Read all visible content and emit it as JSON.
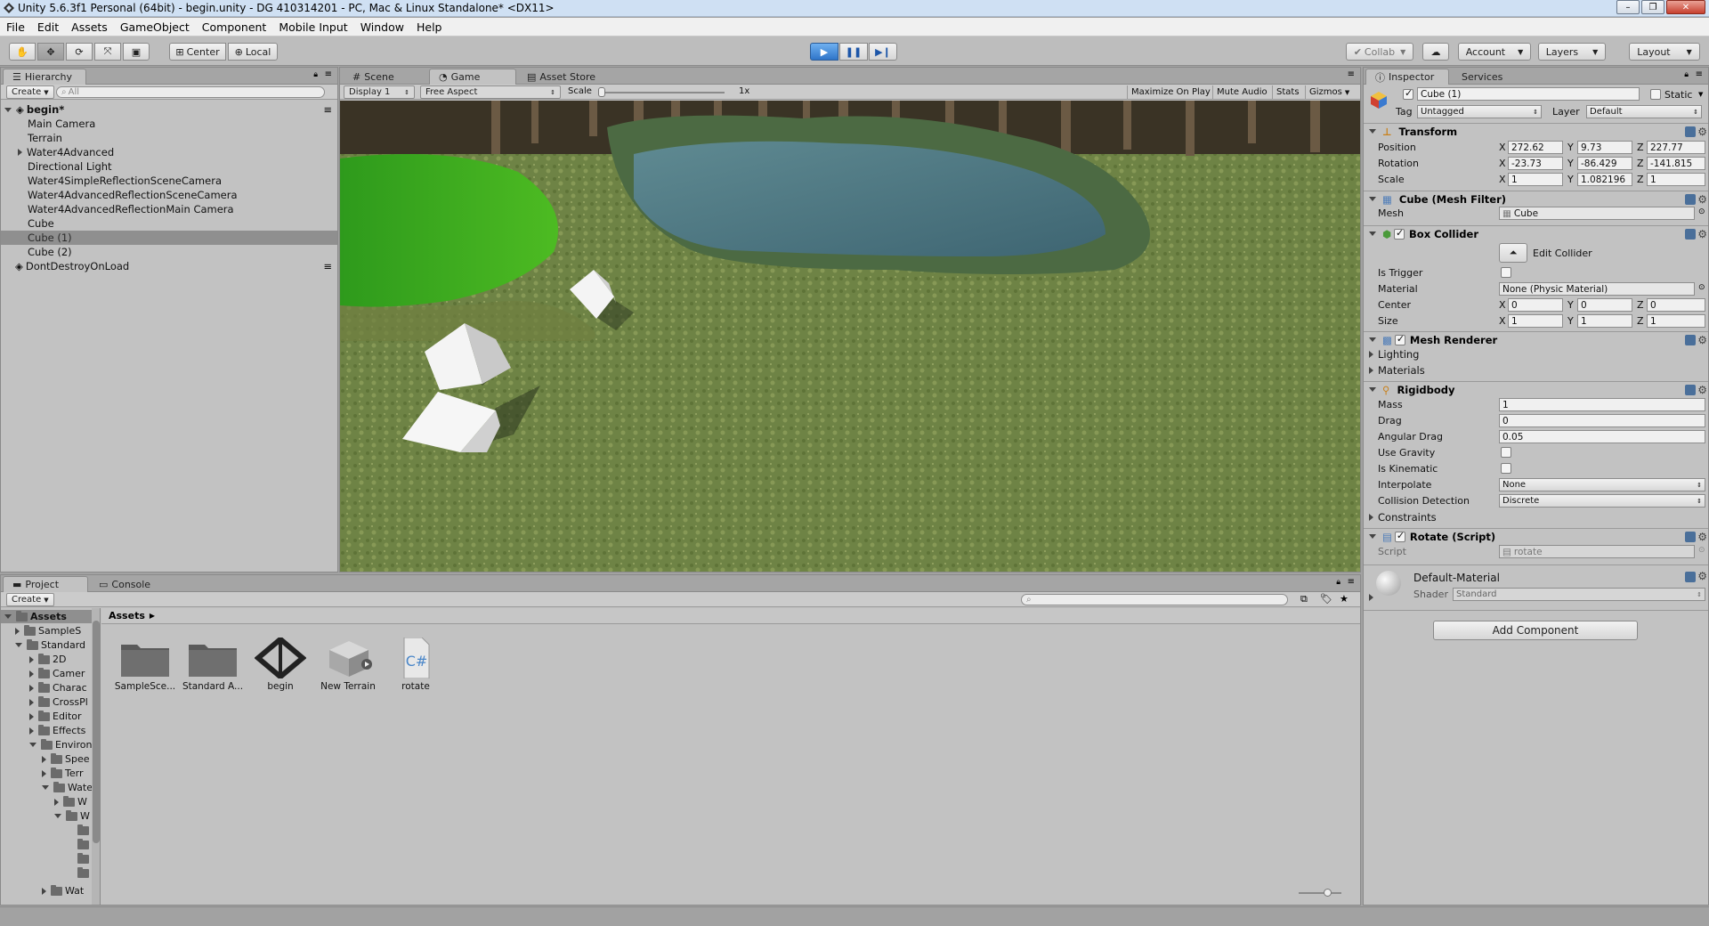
{
  "window": {
    "title": "Unity 5.6.3f1 Personal (64bit) - begin.unity - DG  410314201 - PC, Mac & Linux Standalone* <DX11>"
  },
  "menu": [
    "File",
    "Edit",
    "Assets",
    "GameObject",
    "Component",
    "Mobile Input",
    "Window",
    "Help"
  ],
  "toolbar": {
    "center": "Center",
    "local": "Local",
    "collab": "Collab",
    "account": "Account",
    "layers": "Layers",
    "layout": "Layout"
  },
  "hierarchy": {
    "tab": "Hierarchy",
    "create": "Create",
    "search_placeholder": "All",
    "scene": "begin*",
    "items": [
      "Main Camera",
      "Terrain",
      "Water4Advanced",
      "Directional Light",
      "Water4SimpleReflectionSceneCamera",
      "Water4AdvancedReflectionSceneCamera",
      "Water4AdvancedReflectionMain Camera",
      "Cube",
      "Cube (1)",
      "Cube (2)"
    ],
    "dont_destroy": "DontDestroyOnLoad"
  },
  "game": {
    "tabs": [
      "Scene",
      "Game",
      "Asset Store"
    ],
    "display": "Display 1",
    "aspect": "Free Aspect",
    "scale_label": "Scale",
    "scale_value": "1x",
    "toggles": [
      "Maximize On Play",
      "Mute Audio",
      "Stats",
      "Gizmos"
    ]
  },
  "inspector": {
    "tabs": [
      "Inspector",
      "Services"
    ],
    "object_name": "Cube (1)",
    "static": "Static",
    "tag_label": "Tag",
    "tag": "Untagged",
    "layer_label": "Layer",
    "layer": "Default",
    "transform": {
      "title": "Transform",
      "position_label": "Position",
      "rotation_label": "Rotation",
      "scale_label": "Scale",
      "position": [
        "272.62",
        "9.73",
        "227.77"
      ],
      "rotation": [
        "-23.73",
        "-86.429",
        "-141.815"
      ],
      "scale": [
        "1",
        "1.082196",
        "1"
      ]
    },
    "axes": [
      "X",
      "Y",
      "Z"
    ],
    "mesh_filter": {
      "title": "Cube (Mesh Filter)",
      "mesh_label": "Mesh",
      "mesh": "Cube"
    },
    "box_collider": {
      "title": "Box Collider",
      "edit": "Edit Collider",
      "is_trigger": "Is Trigger",
      "material_label": "Material",
      "material": "None (Physic Material)",
      "center_label": "Center",
      "center": [
        "0",
        "0",
        "0"
      ],
      "size_label": "Size",
      "size": [
        "1",
        "1",
        "1"
      ]
    },
    "mesh_renderer": {
      "title": "Mesh Renderer",
      "lighting": "Lighting",
      "materials": "Materials"
    },
    "rigidbody": {
      "title": "Rigidbody",
      "mass_label": "Mass",
      "mass": "1",
      "drag_label": "Drag",
      "drag": "0",
      "angular_label": "Angular Drag",
      "angular": "0.05",
      "gravity": "Use Gravity",
      "kinematic": "Is Kinematic",
      "interpolate_label": "Interpolate",
      "interpolate": "None",
      "collision_label": "Collision Detection",
      "collision": "Discrete",
      "constraints": "Constraints"
    },
    "rotate": {
      "title": "Rotate (Script)",
      "script_label": "Script",
      "script": "rotate"
    },
    "material": {
      "name": "Default-Material",
      "shader_label": "Shader",
      "shader": "Standard"
    },
    "add_component": "Add Component"
  },
  "project": {
    "tabs": [
      "Project",
      "Console"
    ],
    "create": "Create",
    "breadcrumb": "Assets",
    "tree": [
      {
        "name": "Assets",
        "indent": 0,
        "open": true
      },
      {
        "name": "SampleS",
        "indent": 1,
        "open": false
      },
      {
        "name": "Standard",
        "indent": 1,
        "open": true
      },
      {
        "name": "2D",
        "indent": 2,
        "open": false
      },
      {
        "name": "Camer",
        "indent": 2,
        "open": false
      },
      {
        "name": "Charac",
        "indent": 2,
        "open": false
      },
      {
        "name": "CrossPl",
        "indent": 2,
        "open": false
      },
      {
        "name": "Editor",
        "indent": 2,
        "open": false
      },
      {
        "name": "Effects",
        "indent": 2,
        "open": false
      },
      {
        "name": "Environ",
        "indent": 2,
        "open": true
      },
      {
        "name": "Spee",
        "indent": 3,
        "open": false
      },
      {
        "name": "Terr",
        "indent": 3,
        "open": false
      },
      {
        "name": "Wate",
        "indent": 3,
        "open": true
      },
      {
        "name": "W",
        "indent": 4,
        "open": false
      },
      {
        "name": "W",
        "indent": 4,
        "open": true
      }
    ],
    "tree_last": "Wat",
    "assets": [
      {
        "name": "SampleSce...",
        "kind": "folder"
      },
      {
        "name": "Standard A...",
        "kind": "folder"
      },
      {
        "name": "begin",
        "kind": "unity"
      },
      {
        "name": "New Terrain",
        "kind": "terrain"
      },
      {
        "name": "rotate",
        "kind": "script"
      }
    ]
  }
}
